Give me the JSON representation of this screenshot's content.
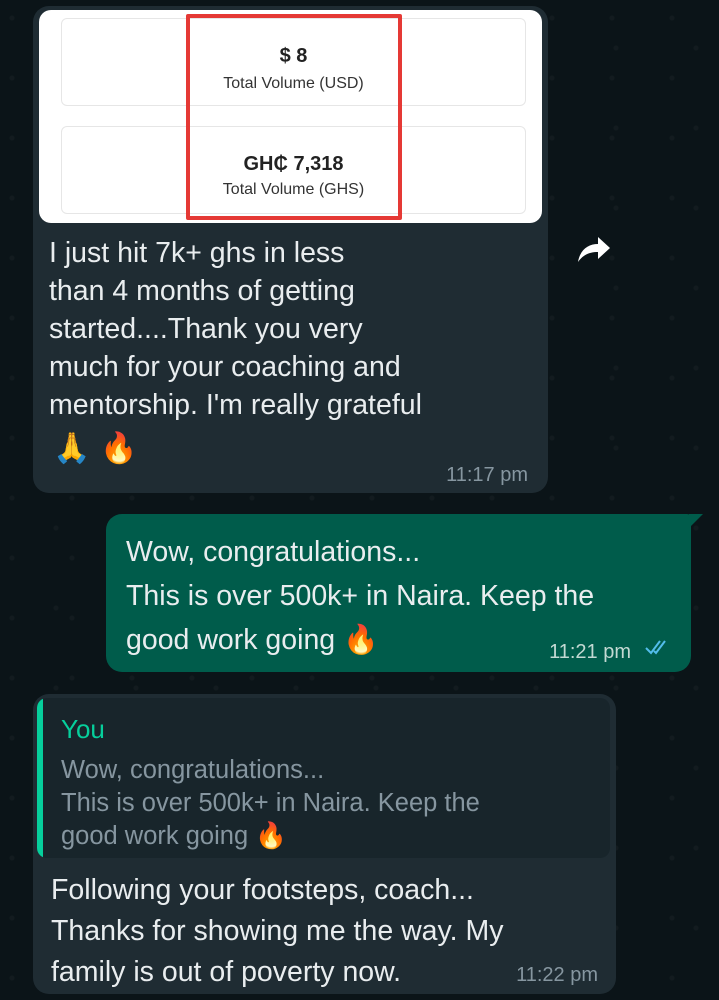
{
  "screenshot": {
    "stats": [
      {
        "value": "$ 8",
        "label": "Total Volume (USD)"
      },
      {
        "value": "GH₵ 7,318",
        "label": "Total Volume (GHS)"
      }
    ]
  },
  "messages": [
    {
      "direction": "incoming",
      "text": "I just hit 7k+ ghs in less\nthan 4 months of getting\nstarted....Thank you very\nmuch for your coaching and\nmentorship. I'm really grateful",
      "emojis": "🙏🔥",
      "time": "11:17 pm"
    },
    {
      "direction": "outgoing",
      "text": "Wow, congratulations...\nThis is over 500k+ in Naira. Keep the\ngood work going 🔥",
      "time": "11:21 pm",
      "status": "read"
    },
    {
      "direction": "incoming",
      "quote": {
        "author": "You",
        "text": "Wow, congratulations...\nThis is over 500k+ in Naira. Keep the\ngood work going 🔥"
      },
      "text": "Following your footsteps, coach...\nThanks for showing me the way. My\nfamily is out of poverty now.",
      "time": "11:22 pm"
    }
  ],
  "colors": {
    "background": "#0b1418",
    "incoming_bubble": "#1f2c33",
    "outgoing_bubble": "#005c4b",
    "quote_accent": "#06cf9c",
    "highlight": "#e53935",
    "read_ticks": "#53bdeb"
  },
  "icons": {
    "forward": "forward-arrow-icon",
    "read_receipt": "double-check-icon"
  }
}
